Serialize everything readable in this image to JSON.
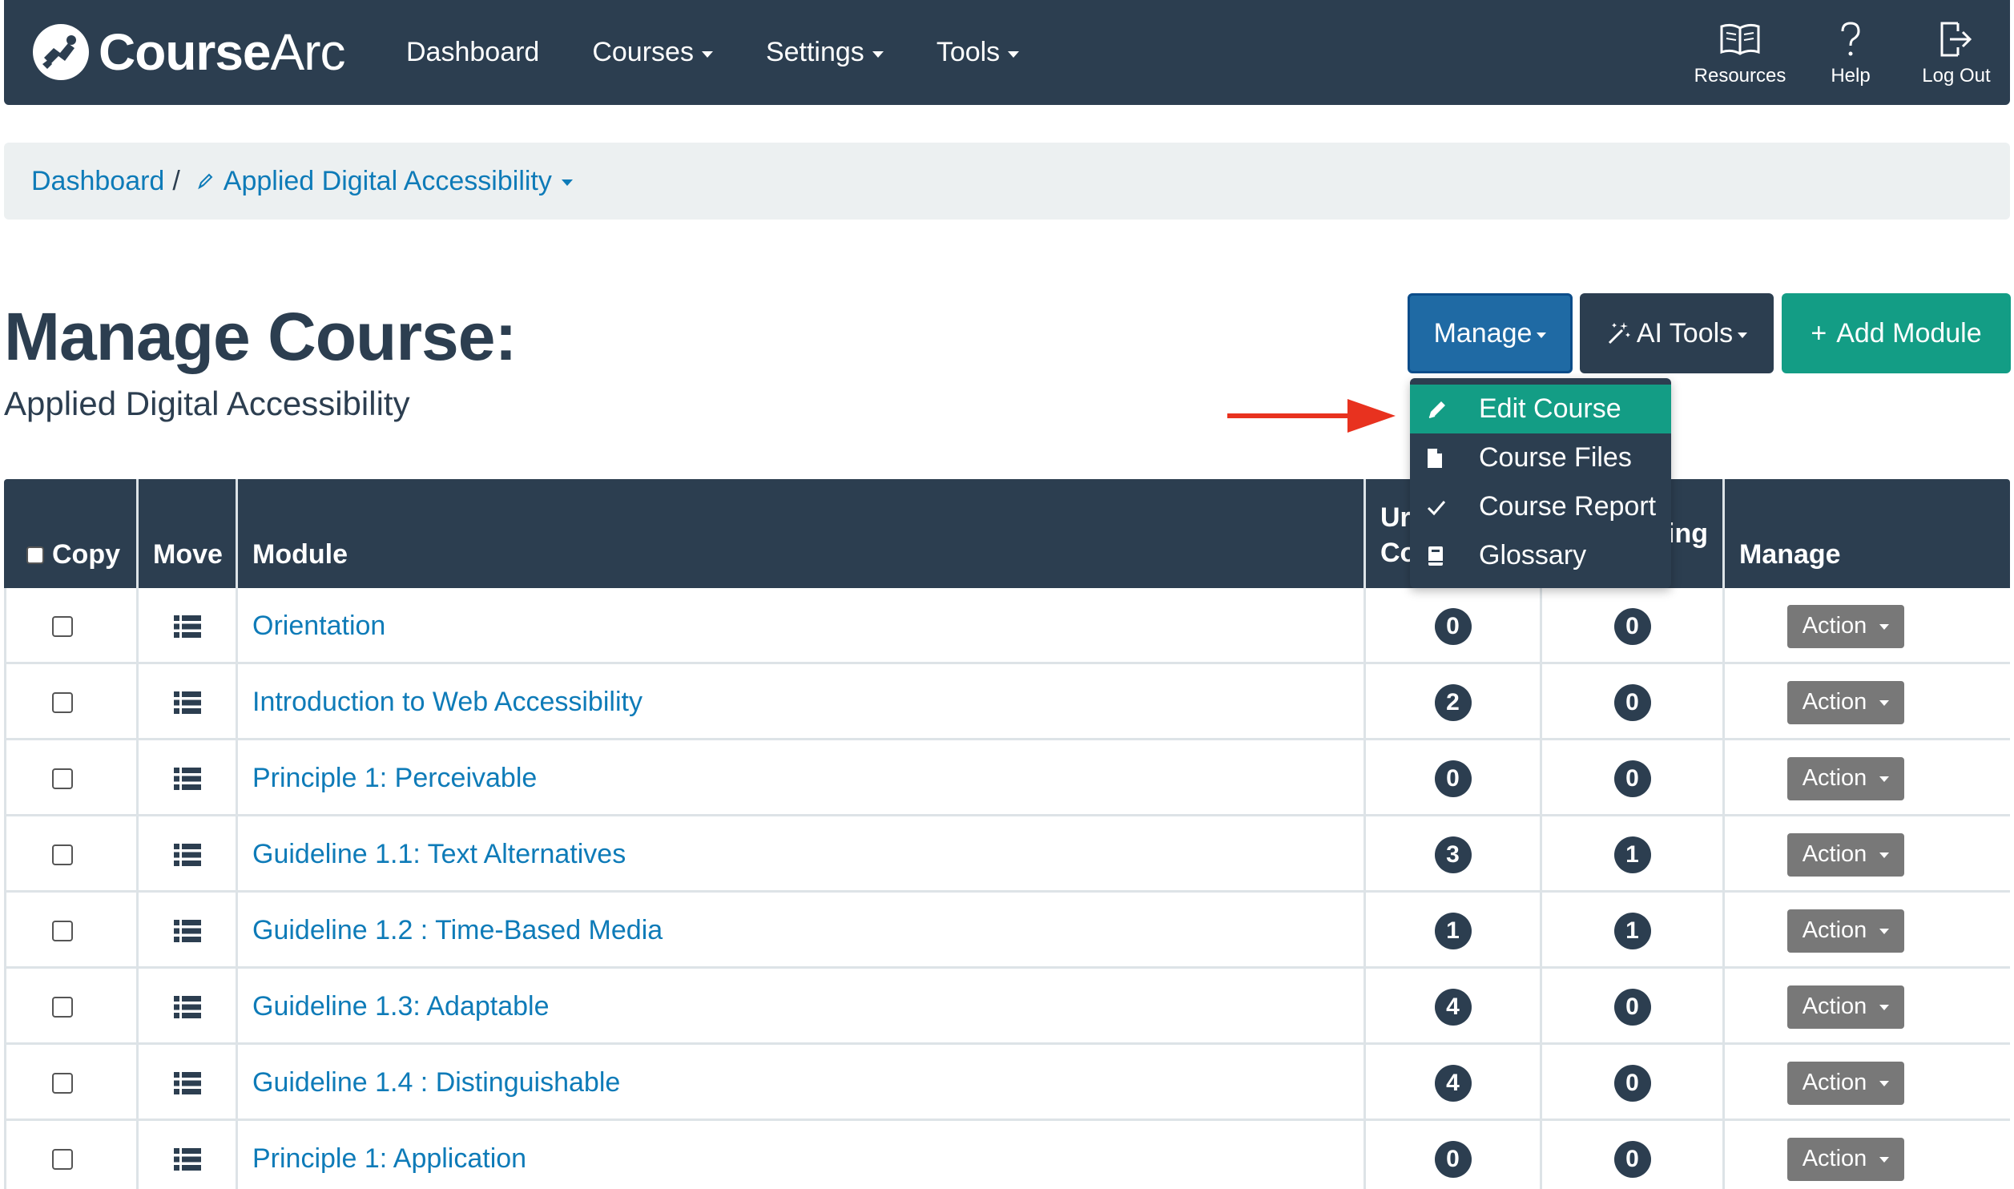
{
  "brand": {
    "name_bold": "Course",
    "name_light": "Arc"
  },
  "nav": {
    "links": [
      {
        "label": "Dashboard",
        "has_caret": false
      },
      {
        "label": "Courses",
        "has_caret": true
      },
      {
        "label": "Settings",
        "has_caret": true
      },
      {
        "label": "Tools",
        "has_caret": true
      }
    ],
    "right": [
      {
        "label": "Resources",
        "icon": "book-icon"
      },
      {
        "label": "Help",
        "icon": "question-icon"
      },
      {
        "label": "Log Out",
        "icon": "logout-icon"
      }
    ]
  },
  "breadcrumb": {
    "home": "Dashboard",
    "separator": "/",
    "current": "Applied Digital Accessibility"
  },
  "page": {
    "title": "Manage Course:",
    "subtitle": "Applied Digital Accessibility"
  },
  "buttons": {
    "manage": "Manage",
    "ai_tools": "AI Tools",
    "add_module_plus": "+",
    "add_module": "Add Module"
  },
  "dropdown": {
    "items": [
      {
        "label": "Edit Course",
        "icon": "pencil-icon",
        "active": true
      },
      {
        "label": "Course Files",
        "icon": "file-icon",
        "active": false
      },
      {
        "label": "Course Report",
        "icon": "check-icon",
        "active": false
      },
      {
        "label": "Glossary",
        "icon": "book-icon",
        "active": false
      }
    ]
  },
  "table": {
    "headers": {
      "copy": "Copy",
      "move": "Move",
      "module": "Module",
      "col4_line1": "Ur",
      "col4_line2": "Co",
      "col5_fragment": "ing",
      "manage": "Manage"
    },
    "action_label": "Action",
    "rows": [
      {
        "module": "Orientation",
        "c1": "0",
        "c2": "0"
      },
      {
        "module": "Introduction to Web Accessibility",
        "c1": "2",
        "c2": "0"
      },
      {
        "module": "Principle 1: Perceivable",
        "c1": "0",
        "c2": "0"
      },
      {
        "module": "Guideline 1.1: Text Alternatives",
        "c1": "3",
        "c2": "1"
      },
      {
        "module": "Guideline 1.2 : Time-Based Media",
        "c1": "1",
        "c2": "1"
      },
      {
        "module": "Guideline 1.3: Adaptable",
        "c1": "4",
        "c2": "0"
      },
      {
        "module": "Guideline 1.4 : Distinguishable",
        "c1": "4",
        "c2": "0"
      },
      {
        "module": "Principle 1: Application",
        "c1": "0",
        "c2": "0"
      }
    ]
  },
  "colors": {
    "navy": "#2c3e50",
    "link": "#0e7bb8",
    "teal": "#139d85",
    "manage_blue": "#1f6aa4",
    "action_gray": "#787878",
    "arrow_red": "#e8321f"
  }
}
